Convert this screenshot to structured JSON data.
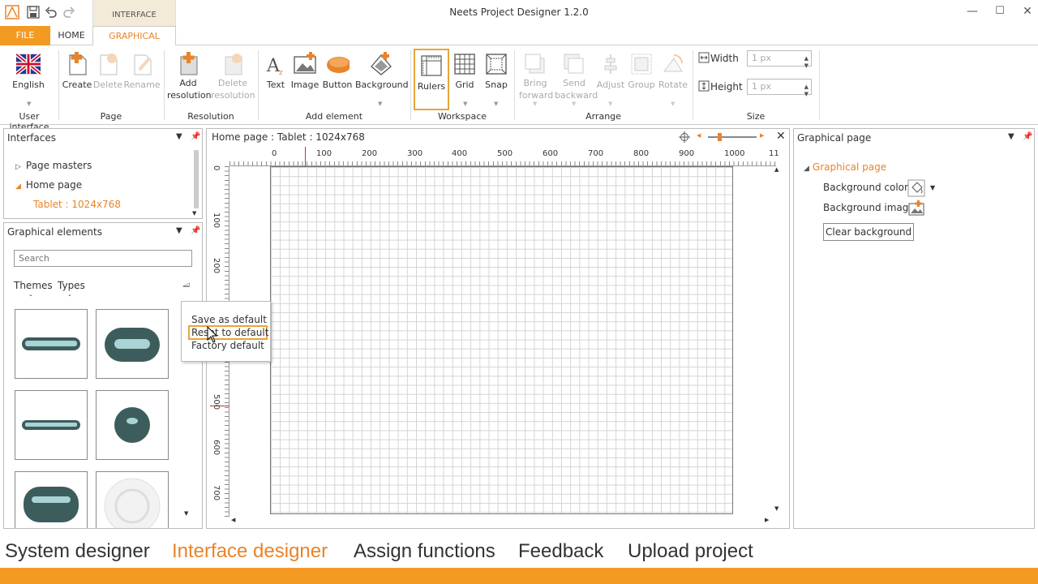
{
  "app": {
    "title": "Neets Project Designer 1.2.0",
    "context_tab": "INTERFACE DESIGNER"
  },
  "tabs": {
    "file": "FILE",
    "home": "HOME",
    "graphical": "GRAPHICAL"
  },
  "ribbon": {
    "user_interface": {
      "english": "English",
      "group": "User interface"
    },
    "page": {
      "create": "Create",
      "delete": "Delete",
      "rename": "Rename",
      "group": "Page"
    },
    "resolution": {
      "add_1": "Add",
      "add_2": "resolution",
      "delete_1": "Delete",
      "delete_2": "resolution",
      "group": "Resolution"
    },
    "add_element": {
      "text": "Text",
      "image": "Image",
      "button": "Button",
      "background": "Background",
      "group": "Add element"
    },
    "workspace": {
      "rulers": "Rulers",
      "grid": "Grid",
      "snap": "Snap",
      "group": "Workspace"
    },
    "arrange": {
      "bring_1": "Bring",
      "bring_2": "forward",
      "send_1": "Send",
      "send_2": "backward",
      "adjust": "Adjust",
      "group_btn": "Group",
      "rotate": "Rotate",
      "group": "Arrange"
    },
    "size": {
      "width_label": "Width",
      "width_value": "1 px",
      "height_label": "Height",
      "height_value": "1 px",
      "group": "Size"
    }
  },
  "interfaces": {
    "title": "Interfaces",
    "items": [
      "Page masters",
      "Home page",
      "Tablet : 1024x768"
    ]
  },
  "graphical_elements": {
    "title": "Graphical elements",
    "search_placeholder": "Search",
    "themes": "Themes",
    "types": "Types"
  },
  "canvas": {
    "title": "Home page : Tablet : 1024x768",
    "x_ticks": [
      "0",
      "100",
      "200",
      "300",
      "400",
      "500",
      "600",
      "700",
      "800",
      "900",
      "1000",
      "11"
    ],
    "y_ticks": [
      "0",
      "100",
      "200",
      "500",
      "600",
      "700"
    ]
  },
  "context_menu": {
    "items": [
      "Save as default",
      "Reset to default",
      "Factory default"
    ]
  },
  "properties": {
    "title": "Graphical page",
    "section": "Graphical page",
    "background_color": "Background color",
    "background_image": "Background image",
    "clear_background": "Clear background"
  },
  "bottom_nav": [
    "System designer",
    "Interface designer",
    "Assign functions",
    "Feedback",
    "Upload project"
  ],
  "colors": {
    "accent": "#f39a22",
    "active_nav": "#e8842a"
  }
}
